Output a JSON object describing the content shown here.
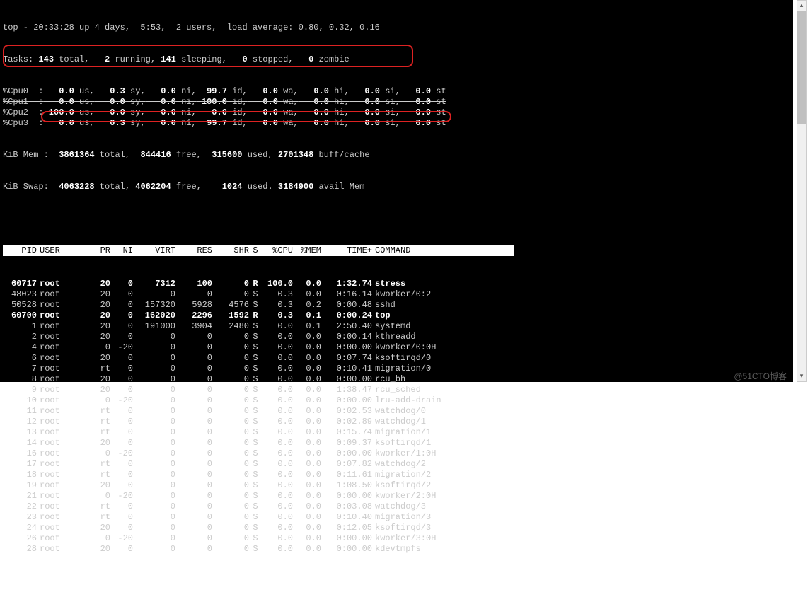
{
  "summary": {
    "line1": "top - 20:33:28 up 4 days,  5:53,  2 users,  load average: 0.80, 0.32, 0.16",
    "tasks_label": "Tasks:",
    "tasks_total": "143",
    "tasks_total_lbl": " total,   ",
    "tasks_running": "2",
    "tasks_running_lbl": " running, ",
    "tasks_sleeping": "141",
    "tasks_sleeping_lbl": " sleeping,   ",
    "tasks_stopped": "0",
    "tasks_stopped_lbl": " stopped,   ",
    "tasks_zombie": "0",
    "tasks_zombie_lbl": " zombie",
    "cpus": [
      {
        "name": "%Cpu0  :",
        "us": "0.0",
        "sy": "0.3",
        "ni": "0.0",
        "id": "99.7",
        "wa": "0.0",
        "hi": "0.0",
        "si": "0.0",
        "st": "0.0",
        "strike": false
      },
      {
        "name": "%Cpu1  :",
        "us": "0.0",
        "sy": "0.0",
        "ni": "0.0",
        "id": "100.0",
        "wa": "0.0",
        "hi": "0.0",
        "si": "0.0",
        "st": "0.0",
        "strike": true
      },
      {
        "name": "%Cpu2  :",
        "us": "100.0",
        "sy": "0.0",
        "ni": "0.0",
        "id": "0.0",
        "wa": "0.0",
        "hi": "0.0",
        "si": "0.0",
        "st": "0.0",
        "strike": false
      },
      {
        "name": "%Cpu3  :",
        "us": "0.0",
        "sy": "0.3",
        "ni": "0.0",
        "id": "99.7",
        "wa": "0.0",
        "hi": "0.0",
        "si": "0.0",
        "st": "0.0",
        "strike": false
      }
    ],
    "mem_label": "KiB Mem :",
    "mem_total": "3861364",
    "mem_total_lbl": " total,  ",
    "mem_free": "844416",
    "mem_free_lbl": " free,  ",
    "mem_used": "315600",
    "mem_used_lbl": " used, ",
    "mem_cache": "2701348",
    "mem_cache_lbl": " buff/cache",
    "swap_label": "KiB Swap:",
    "swap_total": "4063228",
    "swap_total_lbl": " total, ",
    "swap_free": "4062204",
    "swap_free_lbl": " free,    ",
    "swap_used": "1024",
    "swap_used_lbl": " used. ",
    "swap_avail": "3184900",
    "swap_avail_lbl": " avail Mem"
  },
  "columns": [
    "PID",
    "USER",
    "PR",
    "NI",
    "VIRT",
    "RES",
    "SHR",
    "S",
    "%CPU",
    "%MEM",
    "TIME+",
    "COMMAND"
  ],
  "processes": [
    {
      "pid": "60717",
      "user": "root",
      "pr": "20",
      "ni": "0",
      "virt": "7312",
      "res": "100",
      "shr": "0",
      "s": "R",
      "cpu": "100.0",
      "mem": "0.0",
      "time": "1:32.74",
      "cmd": "stress",
      "bold": true
    },
    {
      "pid": "48023",
      "user": "root",
      "pr": "20",
      "ni": "0",
      "virt": "0",
      "res": "0",
      "shr": "0",
      "s": "S",
      "cpu": "0.3",
      "mem": "0.0",
      "time": "0:16.14",
      "cmd": "kworker/0:2"
    },
    {
      "pid": "50528",
      "user": "root",
      "pr": "20",
      "ni": "0",
      "virt": "157320",
      "res": "5928",
      "shr": "4576",
      "s": "S",
      "cpu": "0.3",
      "mem": "0.2",
      "time": "0:00.48",
      "cmd": "sshd"
    },
    {
      "pid": "60700",
      "user": "root",
      "pr": "20",
      "ni": "0",
      "virt": "162020",
      "res": "2296",
      "shr": "1592",
      "s": "R",
      "cpu": "0.3",
      "mem": "0.1",
      "time": "0:00.24",
      "cmd": "top",
      "bold": true
    },
    {
      "pid": "1",
      "user": "root",
      "pr": "20",
      "ni": "0",
      "virt": "191000",
      "res": "3904",
      "shr": "2480",
      "s": "S",
      "cpu": "0.0",
      "mem": "0.1",
      "time": "2:50.40",
      "cmd": "systemd"
    },
    {
      "pid": "2",
      "user": "root",
      "pr": "20",
      "ni": "0",
      "virt": "0",
      "res": "0",
      "shr": "0",
      "s": "S",
      "cpu": "0.0",
      "mem": "0.0",
      "time": "0:00.14",
      "cmd": "kthreadd"
    },
    {
      "pid": "4",
      "user": "root",
      "pr": "0",
      "ni": "-20",
      "virt": "0",
      "res": "0",
      "shr": "0",
      "s": "S",
      "cpu": "0.0",
      "mem": "0.0",
      "time": "0:00.00",
      "cmd": "kworker/0:0H"
    },
    {
      "pid": "6",
      "user": "root",
      "pr": "20",
      "ni": "0",
      "virt": "0",
      "res": "0",
      "shr": "0",
      "s": "S",
      "cpu": "0.0",
      "mem": "0.0",
      "time": "0:07.74",
      "cmd": "ksoftirqd/0"
    },
    {
      "pid": "7",
      "user": "root",
      "pr": "rt",
      "ni": "0",
      "virt": "0",
      "res": "0",
      "shr": "0",
      "s": "S",
      "cpu": "0.0",
      "mem": "0.0",
      "time": "0:10.41",
      "cmd": "migration/0"
    },
    {
      "pid": "8",
      "user": "root",
      "pr": "20",
      "ni": "0",
      "virt": "0",
      "res": "0",
      "shr": "0",
      "s": "S",
      "cpu": "0.0",
      "mem": "0.0",
      "time": "0:00.00",
      "cmd": "rcu_bh"
    },
    {
      "pid": "9",
      "user": "root",
      "pr": "20",
      "ni": "0",
      "virt": "0",
      "res": "0",
      "shr": "0",
      "s": "S",
      "cpu": "0.0",
      "mem": "0.0",
      "time": "1:38.47",
      "cmd": "rcu_sched"
    },
    {
      "pid": "10",
      "user": "root",
      "pr": "0",
      "ni": "-20",
      "virt": "0",
      "res": "0",
      "shr": "0",
      "s": "S",
      "cpu": "0.0",
      "mem": "0.0",
      "time": "0:00.00",
      "cmd": "lru-add-drain"
    },
    {
      "pid": "11",
      "user": "root",
      "pr": "rt",
      "ni": "0",
      "virt": "0",
      "res": "0",
      "shr": "0",
      "s": "S",
      "cpu": "0.0",
      "mem": "0.0",
      "time": "0:02.53",
      "cmd": "watchdog/0"
    },
    {
      "pid": "12",
      "user": "root",
      "pr": "rt",
      "ni": "0",
      "virt": "0",
      "res": "0",
      "shr": "0",
      "s": "S",
      "cpu": "0.0",
      "mem": "0.0",
      "time": "0:02.89",
      "cmd": "watchdog/1"
    },
    {
      "pid": "13",
      "user": "root",
      "pr": "rt",
      "ni": "0",
      "virt": "0",
      "res": "0",
      "shr": "0",
      "s": "S",
      "cpu": "0.0",
      "mem": "0.0",
      "time": "0:15.74",
      "cmd": "migration/1"
    },
    {
      "pid": "14",
      "user": "root",
      "pr": "20",
      "ni": "0",
      "virt": "0",
      "res": "0",
      "shr": "0",
      "s": "S",
      "cpu": "0.0",
      "mem": "0.0",
      "time": "0:09.37",
      "cmd": "ksoftirqd/1"
    },
    {
      "pid": "16",
      "user": "root",
      "pr": "0",
      "ni": "-20",
      "virt": "0",
      "res": "0",
      "shr": "0",
      "s": "S",
      "cpu": "0.0",
      "mem": "0.0",
      "time": "0:00.00",
      "cmd": "kworker/1:0H"
    },
    {
      "pid": "17",
      "user": "root",
      "pr": "rt",
      "ni": "0",
      "virt": "0",
      "res": "0",
      "shr": "0",
      "s": "S",
      "cpu": "0.0",
      "mem": "0.0",
      "time": "0:07.82",
      "cmd": "watchdog/2"
    },
    {
      "pid": "18",
      "user": "root",
      "pr": "rt",
      "ni": "0",
      "virt": "0",
      "res": "0",
      "shr": "0",
      "s": "S",
      "cpu": "0.0",
      "mem": "0.0",
      "time": "0:11.61",
      "cmd": "migration/2"
    },
    {
      "pid": "19",
      "user": "root",
      "pr": "20",
      "ni": "0",
      "virt": "0",
      "res": "0",
      "shr": "0",
      "s": "S",
      "cpu": "0.0",
      "mem": "0.0",
      "time": "1:08.50",
      "cmd": "ksoftirqd/2"
    },
    {
      "pid": "21",
      "user": "root",
      "pr": "0",
      "ni": "-20",
      "virt": "0",
      "res": "0",
      "shr": "0",
      "s": "S",
      "cpu": "0.0",
      "mem": "0.0",
      "time": "0:00.00",
      "cmd": "kworker/2:0H"
    },
    {
      "pid": "22",
      "user": "root",
      "pr": "rt",
      "ni": "0",
      "virt": "0",
      "res": "0",
      "shr": "0",
      "s": "S",
      "cpu": "0.0",
      "mem": "0.0",
      "time": "0:03.08",
      "cmd": "watchdog/3"
    },
    {
      "pid": "23",
      "user": "root",
      "pr": "rt",
      "ni": "0",
      "virt": "0",
      "res": "0",
      "shr": "0",
      "s": "S",
      "cpu": "0.0",
      "mem": "0.0",
      "time": "0:10.40",
      "cmd": "migration/3"
    },
    {
      "pid": "24",
      "user": "root",
      "pr": "20",
      "ni": "0",
      "virt": "0",
      "res": "0",
      "shr": "0",
      "s": "S",
      "cpu": "0.0",
      "mem": "0.0",
      "time": "0:12.05",
      "cmd": "ksoftirqd/3"
    },
    {
      "pid": "26",
      "user": "root",
      "pr": "0",
      "ni": "-20",
      "virt": "0",
      "res": "0",
      "shr": "0",
      "s": "S",
      "cpu": "0.0",
      "mem": "0.0",
      "time": "0:00.00",
      "cmd": "kworker/3:0H"
    },
    {
      "pid": "28",
      "user": "root",
      "pr": "20",
      "ni": "0",
      "virt": "0",
      "res": "0",
      "shr": "0",
      "s": "S",
      "cpu": "0.0",
      "mem": "0.0",
      "time": "0:00.00",
      "cmd": "kdevtmpfs"
    }
  ],
  "watermark": "@51CTO博客"
}
